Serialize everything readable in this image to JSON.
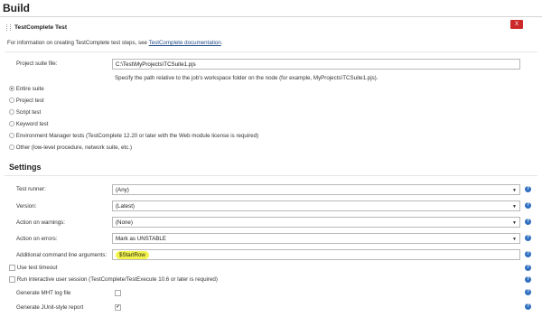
{
  "page": {
    "title": "Build"
  },
  "step": {
    "title": "TestComplete Test",
    "delete_label": "X",
    "info_prefix": "For information on creating TestComplete test steps, see ",
    "info_link": "TestComplete documentation",
    "info_suffix": ".",
    "project_suite": {
      "label": "Project suite file:",
      "value": "C:\\Test\\MyProjects\\TCSuite1.pjs",
      "hint": "Specify the path relative to the job's workspace folder on the node (for example, MyProjects\\TCSuite1.pjs)."
    },
    "scope_options": [
      {
        "label": "Entire suite",
        "selected": true
      },
      {
        "label": "Project test",
        "selected": false
      },
      {
        "label": "Script test",
        "selected": false
      },
      {
        "label": "Keyword test",
        "selected": false
      },
      {
        "label": "Environment Manager tests (TestComplete 12.20 or later with the Web module license is required)",
        "selected": false
      },
      {
        "label": "Other (low-level procedure, network suite, etc.)",
        "selected": false
      }
    ]
  },
  "settings": {
    "title": "Settings",
    "test_runner": {
      "label": "Test runner:",
      "value": "(Any)"
    },
    "version": {
      "label": "Version:",
      "value": "(Latest)"
    },
    "action_warnings": {
      "label": "Action on warnings:",
      "value": "(None)"
    },
    "action_errors": {
      "label": "Action on errors:",
      "value": "Mark as UNSTABLE"
    },
    "cmd_args": {
      "label": "Additional command line arguments:",
      "value": "$StartRow"
    },
    "use_timeout": {
      "label": "Use test timeout",
      "checked": false
    },
    "interactive": {
      "label": "Run interactive user session (TestComplete/TestExecute 10.6 or later is required)",
      "checked": false
    },
    "mht_log": {
      "label": "Generate MHT log file",
      "checked": false
    },
    "junit": {
      "label": "Generate JUnit-style report",
      "checked": true
    }
  },
  "help_glyph": "?",
  "check_glyph": "✔"
}
